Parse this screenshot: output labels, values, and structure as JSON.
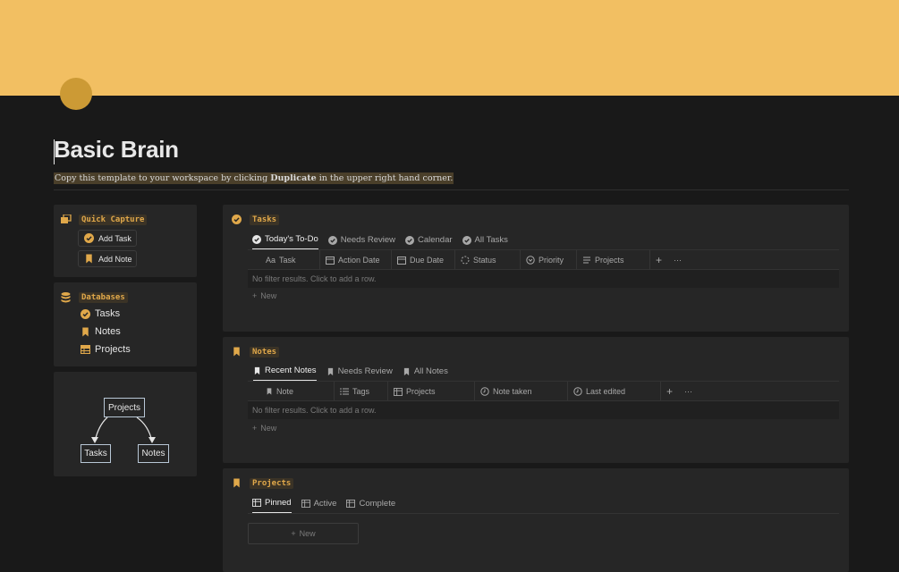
{
  "page": {
    "title": "Basic Brain",
    "subtitle_pre": "Copy this template to your workspace by clicking ",
    "subtitle_bold": "Duplicate",
    "subtitle_post": " in the upper right hand corner."
  },
  "colors": {
    "cover": "#f2bf62",
    "accent": "#e0a84a",
    "background": "#191919",
    "card": "#262626"
  },
  "quick_capture": {
    "label": "Quick Capture",
    "buttons": [
      {
        "label": "Add Task",
        "icon": "check-circle-icon"
      },
      {
        "label": "Add Note",
        "icon": "bookmark-icon"
      }
    ]
  },
  "databases": {
    "label": "Databases",
    "links": [
      {
        "label": "Tasks",
        "icon": "check-circle-icon"
      },
      {
        "label": "Notes",
        "icon": "bookmark-icon"
      },
      {
        "label": "Projects",
        "icon": "table-icon"
      }
    ]
  },
  "diagram": {
    "top": "Projects",
    "left": "Tasks",
    "right": "Notes"
  },
  "tasks": {
    "label": "Tasks",
    "tabs": [
      "Today's To-Do",
      "Needs Review",
      "Calendar",
      "All Tasks"
    ],
    "columns": [
      "Task",
      "Action Date",
      "Due Date",
      "Status",
      "Priority",
      "Projects"
    ],
    "title_prefix": "Aa",
    "empty_text": "No filter results. Click to add a row.",
    "new_label": "New"
  },
  "notes": {
    "label": "Notes",
    "tabs": [
      "Recent Notes",
      "Needs Review",
      "All Notes"
    ],
    "columns": [
      "Note",
      "Tags",
      "Projects",
      "Note taken",
      "Last edited"
    ],
    "empty_text": "No filter results. Click to add a row.",
    "new_label": "New"
  },
  "projects": {
    "label": "Projects",
    "tabs": [
      "Pinned",
      "Active",
      "Complete"
    ],
    "new_label": "New"
  },
  "toolbar": {
    "add": "+",
    "more": "···"
  }
}
